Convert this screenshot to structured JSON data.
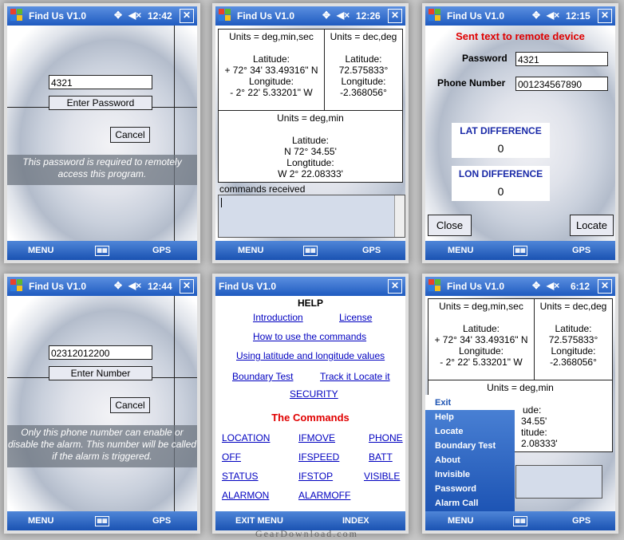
{
  "app_title": "Find Us V1.0",
  "menubar": {
    "menu": "MENU",
    "gps": "GPS"
  },
  "screen1": {
    "clock": "12:42",
    "password_value": "4321",
    "enter_button": "Enter Password",
    "cancel_button": "Cancel",
    "note": "This password is required to remotely access this program."
  },
  "screen2": {
    "clock": "12:26",
    "cell1": {
      "units": "Units = deg,min,sec",
      "lat_label": "Latitude:",
      "lat_value": "+ 72° 34' 33.49316\" N",
      "lon_label": "Longitude:",
      "lon_value": "- 2° 22' 5.33201\" W"
    },
    "cell2": {
      "units": "Units = dec,deg",
      "lat_label": "Latitude:",
      "lat_value": "72.575833°",
      "lon_label": "Longitude:",
      "lon_value": "-2.368056°"
    },
    "cell3": {
      "units": "Units = deg,min",
      "lat_label": "Latitude:",
      "lat_value": "N 72° 34.55'",
      "lon_label": "Longtitude:",
      "lon_value": "W 2° 22.08333'"
    },
    "commands_label": "commands received"
  },
  "screen3": {
    "clock": "12:15",
    "header": "Sent text to remote device",
    "password_label": "Password",
    "password_value": "4321",
    "phone_label": "Phone Number",
    "phone_value": "001234567890",
    "lat_diff_label": "LAT DIFFERENCE",
    "lat_diff_value": "0",
    "lon_diff_label": "LON DIFFERENCE",
    "lon_diff_value": "0",
    "close_button": "Close",
    "locate_button": "Locate"
  },
  "screen4": {
    "clock": "12:44",
    "number_value": "02312012200",
    "enter_button": "Enter Number",
    "cancel_button": "Cancel",
    "note": "Only this phone number can enable or disable the alarm. This number will be called if the alarm is triggered."
  },
  "screen5": {
    "help_title": "HELP",
    "links": [
      "Introduction",
      "License",
      "How to use the commands",
      "Using latitude and longitude values",
      "Boundary Test",
      "Track it Locate it",
      "SECURITY"
    ],
    "commands_title": "The Commands",
    "commands": [
      "LOCATION",
      "IFMOVE",
      "PHONE",
      "OFF",
      "IFSPEED",
      "BATT",
      "STATUS",
      "IFSTOP",
      "VISIBLE",
      "ALARMON",
      "ALARMOFF"
    ],
    "exit_menu": "EXIT MENU",
    "index": "INDEX"
  },
  "screen6": {
    "clock": "6:12",
    "cell1": {
      "units": "Units = deg,min,sec",
      "lat_label": "Latitude:",
      "lat_value": "+ 72° 34' 33.49316\" N",
      "lon_label": "Longitude:",
      "lon_value": "- 2° 22' 5.33201\" W"
    },
    "cell2": {
      "units": "Units = dec,deg",
      "lat_label": "Latitude:",
      "lat_value": "72.575833°",
      "lon_label": "Longitude:",
      "lon_value": "-2.368056°"
    },
    "cell3": {
      "units": "Units = deg,min",
      "frag1": "ude:",
      "frag2": "34.55'",
      "frag3": "titude:",
      "frag4": "2.08333'"
    },
    "menu_items": [
      "Exit",
      "Help",
      "Locate",
      "Boundary Test",
      "About",
      "Invisible",
      "Password",
      "Alarm Call"
    ]
  },
  "watermark": "GearDownload.com"
}
